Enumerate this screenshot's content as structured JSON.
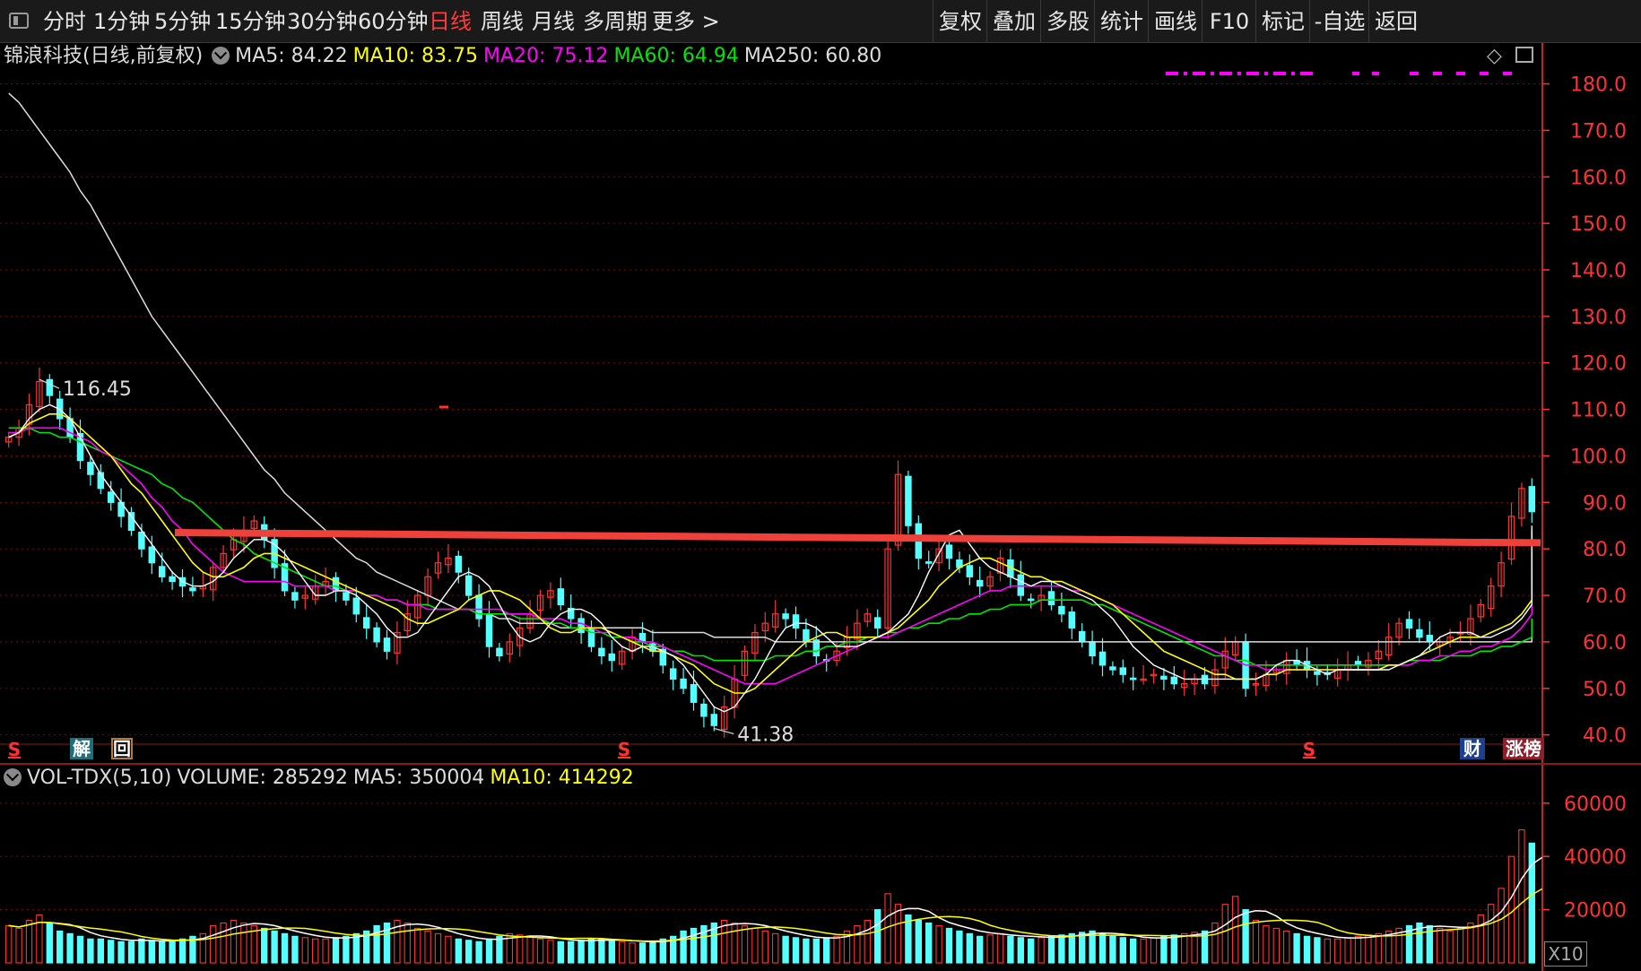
{
  "toolbar": {
    "tabs": [
      "分时",
      "1分钟",
      "5分钟",
      "15分钟",
      "30分钟",
      "60分钟",
      "日线",
      "周线",
      "月线",
      "多周期",
      "更多 >"
    ],
    "active_tab": "日线",
    "buttons": [
      "复权",
      "叠加",
      "多股",
      "统计",
      "画线",
      "F10",
      "标记",
      "-自选",
      "返回"
    ]
  },
  "info": {
    "stock": "锦浪科技(日线,前复权)",
    "ma5": "MA5: 84.22",
    "ma10": "MA10: 83.75",
    "ma20": "MA20: 75.12",
    "ma60": "MA60: 64.94",
    "ma250": "MA250: 60.80"
  },
  "volume_info": {
    "name": "VOL-TDX(5,10)",
    "volume": "VOLUME: 285292",
    "ma5": "MA5: 350004",
    "ma10": "MA10: 414292"
  },
  "markers": {
    "s": "S",
    "jie": "解",
    "hui": "回",
    "cai": "财",
    "zhang": "涨榜",
    "x10": "X10"
  },
  "colors": {
    "up": "#ff3232",
    "down": "#54ffff",
    "ma5": "#ffffff",
    "ma10": "#ffff00",
    "ma20": "#ff00ff",
    "ma60": "#00e600",
    "ma250": "#dcdcdc",
    "trendline": "#f0403a",
    "grid": "#8b0000",
    "axis": "#ff3232"
  },
  "chart_data": {
    "type": "candlestick",
    "price_axis": {
      "ticks": [
        180,
        170,
        160,
        150,
        140,
        130,
        120,
        110,
        100,
        90,
        80,
        70,
        60,
        50,
        40
      ],
      "tick_labels": [
        "180.0",
        "170.0",
        "160.0",
        "150.0",
        "140.0",
        "130.0",
        "120.0",
        "110.0",
        "100.0",
        "90.0",
        "80.0",
        "70.0",
        "60.0",
        "50.0",
        "40.0"
      ],
      "range": [
        38,
        183
      ]
    },
    "volume_axis": {
      "ticks": [
        60000,
        40000,
        20000
      ],
      "tick_labels": [
        "60000",
        "40000",
        "20000"
      ],
      "range": [
        0,
        66000
      ],
      "multiplier_label": "X10"
    },
    "annotations": [
      {
        "label": "116.45",
        "price": 116.45,
        "type": "high"
      },
      {
        "label": "41.38",
        "price": 41.38,
        "type": "low"
      }
    ],
    "trendline": {
      "from_price": 83.5,
      "to_price": 81.3
    },
    "close_series": [
      104,
      106,
      111,
      116,
      113,
      108,
      104,
      99,
      96,
      93,
      90,
      87,
      84,
      80,
      77,
      74,
      73,
      72,
      71,
      72,
      76,
      79,
      82,
      84,
      86,
      82,
      76,
      71,
      69,
      70,
      72,
      73,
      71,
      69,
      66,
      63,
      60,
      58,
      62,
      66,
      70,
      74,
      77,
      78,
      75,
      70,
      65,
      59,
      57,
      60,
      63,
      66,
      70,
      71,
      68,
      65,
      62,
      59,
      57,
      56,
      58,
      61,
      60,
      58,
      55,
      52,
      50,
      47,
      44,
      42,
      46,
      52,
      58,
      62,
      64,
      66,
      65,
      63,
      60,
      57,
      56,
      58,
      61,
      64,
      66,
      63,
      80,
      96,
      85,
      78,
      77,
      80,
      78,
      76,
      74,
      72,
      74,
      78,
      74,
      70,
      69,
      70,
      68,
      66,
      63,
      60,
      57,
      55,
      54,
      53,
      52,
      52,
      53,
      52,
      51,
      51,
      52,
      51,
      54,
      58,
      60,
      50,
      51,
      53,
      54,
      56,
      55,
      54,
      53,
      53,
      54,
      55,
      55,
      56,
      58,
      61,
      64,
      63,
      61,
      60,
      60,
      61,
      62,
      65,
      68,
      72,
      77,
      87,
      93,
      88
    ],
    "ma5": [
      104,
      105,
      108,
      110,
      111,
      110,
      108,
      104,
      100,
      96,
      93,
      90,
      87,
      84,
      81,
      78,
      75,
      73,
      72,
      72,
      73,
      75,
      78,
      80,
      82,
      82,
      81,
      79,
      76,
      73,
      70,
      70,
      71,
      71,
      70,
      68,
      66,
      63,
      61,
      61,
      62,
      65,
      68,
      71,
      74,
      75,
      74,
      72,
      68,
      64,
      61,
      60,
      61,
      64,
      66,
      67,
      67,
      66,
      64,
      61,
      59,
      58,
      59,
      59,
      58,
      57,
      55,
      52,
      49,
      46,
      45,
      46,
      49,
      52,
      56,
      60,
      63,
      64,
      64,
      63,
      61,
      59,
      59,
      59,
      60,
      61,
      62,
      64,
      66,
      70,
      75,
      79,
      83,
      84,
      81,
      78,
      76,
      75,
      74,
      73,
      72,
      73,
      73,
      72,
      71,
      70,
      69,
      67,
      65,
      62,
      59,
      57,
      55,
      54,
      53,
      52,
      52,
      52,
      52,
      52,
      52,
      52,
      52,
      53,
      55,
      56,
      56,
      55,
      54,
      53,
      54,
      54,
      54,
      54,
      54,
      54,
      55,
      56,
      57,
      59,
      61,
      62,
      62,
      62,
      61,
      61,
      62,
      63,
      65,
      68,
      72,
      77,
      82,
      85,
      85
    ],
    "ma10": [
      104,
      105,
      107,
      108,
      109,
      109,
      108,
      106,
      104,
      102,
      100,
      97,
      94,
      92,
      89,
      86,
      83,
      80,
      77,
      75,
      74,
      74,
      75,
      76,
      78,
      79,
      79,
      78,
      77,
      76,
      75,
      74,
      73,
      72,
      71,
      70,
      69,
      68,
      67,
      65,
      64,
      64,
      65,
      66,
      67,
      69,
      70,
      71,
      71,
      70,
      69,
      67,
      65,
      63,
      62,
      62,
      63,
      63,
      63,
      62,
      61,
      60,
      59,
      58,
      58,
      57,
      56,
      55,
      53,
      51,
      50,
      49,
      49,
      50,
      52,
      54,
      56,
      58,
      60,
      61,
      62,
      62,
      61,
      61,
      61,
      61,
      62,
      63,
      65,
      67,
      69,
      72,
      74,
      76,
      77,
      78,
      78,
      77,
      76,
      75,
      74,
      74,
      73,
      73,
      72,
      71,
      70,
      69,
      68,
      66,
      64,
      62,
      60,
      58,
      57,
      56,
      55,
      54,
      53,
      53,
      52,
      52,
      52,
      53,
      53,
      54,
      54,
      54,
      54,
      54,
      54,
      54,
      54,
      54,
      54,
      55,
      55,
      56,
      57,
      58,
      59,
      60,
      61,
      61,
      61,
      62,
      63,
      64,
      66,
      69,
      72,
      76,
      80,
      83,
      84
    ],
    "ma20": [
      105,
      105,
      106,
      106,
      106,
      106,
      105,
      104,
      103,
      101,
      100,
      98,
      96,
      94,
      91,
      89,
      86,
      84,
      81,
      79,
      77,
      75,
      74,
      73,
      73,
      73,
      73,
      73,
      72,
      72,
      72,
      72,
      71,
      71,
      71,
      70,
      70,
      69,
      69,
      68,
      68,
      67,
      67,
      67,
      67,
      67,
      67,
      67,
      67,
      66,
      66,
      66,
      65,
      65,
      65,
      64,
      64,
      63,
      62,
      62,
      61,
      61,
      60,
      60,
      59,
      58,
      57,
      56,
      55,
      54,
      53,
      52,
      51,
      51,
      51,
      51,
      52,
      53,
      54,
      55,
      56,
      57,
      58,
      59,
      60,
      61,
      61,
      62,
      63,
      64,
      65,
      66,
      67,
      68,
      69,
      70,
      71,
      71,
      72,
      72,
      72,
      72,
      72,
      72,
      71,
      71,
      70,
      69,
      68,
      67,
      66,
      65,
      64,
      63,
      62,
      61,
      60,
      59,
      58,
      57,
      56,
      55,
      55,
      54,
      54,
      54,
      54,
      54,
      54,
      54,
      54,
      54,
      54,
      54,
      54,
      55,
      55,
      55,
      56,
      56,
      57,
      57,
      58,
      58,
      59,
      59,
      60,
      61,
      63,
      66,
      70,
      75
    ],
    "ma60": [
      106,
      106,
      106,
      105,
      105,
      104,
      104,
      103,
      102,
      101,
      100,
      99,
      98,
      97,
      96,
      94,
      93,
      91,
      90,
      88,
      86,
      84,
      82,
      81,
      79,
      78,
      77,
      76,
      75,
      74,
      73,
      72,
      72,
      71,
      71,
      70,
      70,
      69,
      69,
      68,
      68,
      68,
      67,
      67,
      67,
      67,
      66,
      66,
      66,
      66,
      65,
      65,
      65,
      64,
      64,
      63,
      63,
      62,
      62,
      61,
      61,
      60,
      60,
      59,
      59,
      58,
      58,
      57,
      57,
      56,
      56,
      56,
      56,
      56,
      56,
      57,
      57,
      57,
      58,
      58,
      59,
      59,
      60,
      60,
      61,
      61,
      62,
      62,
      63,
      63,
      64,
      64,
      65,
      65,
      66,
      66,
      67,
      67,
      68,
      68,
      68,
      69,
      69,
      69,
      69,
      69,
      68,
      68,
      67,
      66,
      65,
      64,
      63,
      62,
      61,
      60,
      59,
      58,
      57,
      57,
      56,
      56,
      55,
      55,
      55,
      55,
      55,
      55,
      55,
      55,
      55,
      55,
      55,
      55,
      55,
      55,
      55,
      56,
      56,
      56,
      56,
      57,
      57,
      57,
      58,
      58,
      59,
      59,
      60,
      61,
      62,
      63,
      64,
      65
    ],
    "ma250": [
      178,
      176,
      173,
      170,
      167,
      164,
      161,
      157,
      154,
      150,
      146,
      142,
      138,
      134,
      130,
      127,
      124,
      121,
      118,
      115,
      112,
      109,
      106,
      103,
      100,
      97,
      95,
      92,
      90,
      88,
      86,
      84,
      82,
      80,
      78,
      77,
      75,
      74,
      73,
      72,
      71,
      70,
      69,
      68,
      67,
      67,
      66,
      66,
      65,
      65,
      64,
      64,
      64,
      64,
      63,
      63,
      63,
      63,
      63,
      63,
      63,
      63,
      63,
      62,
      62,
      62,
      62,
      62,
      62,
      61,
      61,
      61,
      61,
      61,
      61,
      60,
      60,
      60,
      60,
      60,
      60,
      60,
      60,
      60,
      60,
      60,
      60,
      60,
      60,
      60,
      60,
      60,
      60,
      60,
      60,
      60,
      60,
      60,
      60,
      60,
      60,
      60,
      60,
      60,
      60,
      60,
      60,
      60,
      60,
      60,
      60,
      60,
      60,
      60,
      60,
      60,
      60,
      60,
      60,
      60,
      60,
      60,
      60,
      60,
      60,
      60,
      60,
      60,
      60,
      60,
      60,
      60,
      60,
      60,
      60,
      60,
      60,
      60,
      60,
      60,
      60,
      60,
      60,
      60,
      60,
      60,
      60,
      60,
      60,
      60,
      61,
      61,
      61,
      61,
      61
    ],
    "volume_series": [
      14000,
      13000,
      16000,
      18000,
      15000,
      12000,
      11000,
      10000,
      9000,
      9000,
      8500,
      8000,
      8000,
      9000,
      8500,
      8000,
      8000,
      9000,
      10000,
      11000,
      14000,
      15000,
      16000,
      15000,
      14000,
      13000,
      12000,
      11000,
      10000,
      9500,
      9000,
      9000,
      9500,
      10000,
      11000,
      12000,
      14000,
      15000,
      16000,
      15000,
      13000,
      12000,
      11000,
      10000,
      9000,
      8500,
      8000,
      9000,
      10000,
      11000,
      10500,
      10000,
      9000,
      8500,
      8000,
      8000,
      8500,
      9000,
      9000,
      8500,
      8000,
      7500,
      7500,
      8000,
      9000,
      10000,
      12000,
      13000,
      14000,
      15000,
      16000,
      15000,
      14000,
      13000,
      12000,
      11000,
      10000,
      9500,
      9000,
      9000,
      9500,
      10000,
      12000,
      14000,
      16000,
      20000,
      26000,
      22000,
      18000,
      16000,
      15000,
      14000,
      13000,
      12000,
      11000,
      10000,
      10500,
      11000,
      10000,
      9500,
      9000,
      9500,
      10000,
      10500,
      11000,
      11500,
      12000,
      11000,
      10000,
      9500,
      9000,
      9000,
      9500,
      10000,
      10500,
      11000,
      11500,
      12000,
      15000,
      22000,
      25000,
      20000,
      16000,
      14000,
      13000,
      12000,
      11000,
      10000,
      9500,
      9000,
      9000,
      9500,
      10000,
      10500,
      11000,
      12000,
      13000,
      14000,
      15000,
      14000,
      13000,
      12000,
      13000,
      15000,
      18000,
      22000,
      28000,
      40000,
      50000,
      45000,
      35000
    ]
  }
}
